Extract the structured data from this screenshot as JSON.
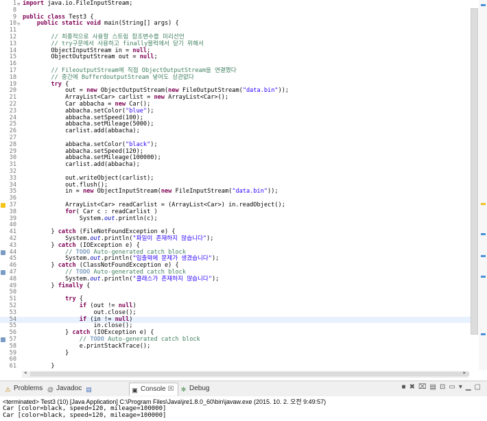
{
  "editor": {
    "lines": [
      {
        "n": "1",
        "fold": "+",
        "code": "import java.io.FileInputStream;"
      },
      {
        "n": "8",
        "code": ""
      },
      {
        "n": "9",
        "code": "public class Test3 {"
      },
      {
        "n": "10",
        "fold": "-",
        "code": "    public static void main(String[] args) {"
      },
      {
        "n": "11",
        "code": ""
      },
      {
        "n": "12",
        "code": "        // 최종적으로 사용할 스트림 참조변수를 미리선언"
      },
      {
        "n": "13",
        "code": "        // try구문에서 사용하고 finally블럭에서 닫기 위해서"
      },
      {
        "n": "14",
        "code": "        ObjectInputStream in = null;"
      },
      {
        "n": "15",
        "code": "        ObjectOutputStream out = null;"
      },
      {
        "n": "16",
        "code": ""
      },
      {
        "n": "17",
        "code": "        // FileoutputStream에 직접 ObjectOutputStream을 연결했다"
      },
      {
        "n": "18",
        "code": "        // 중간에 BufferdoutputStream 넣어도 상관없다"
      },
      {
        "n": "19",
        "code": "        try {"
      },
      {
        "n": "20",
        "code": "            out = new ObjectOutputStream(new FileOutputStream(\"data.bin\"));"
      },
      {
        "n": "21",
        "code": "            ArrayList<Car> carlist = new ArrayList<Car>();"
      },
      {
        "n": "22",
        "code": "            Car abbacha = new Car();"
      },
      {
        "n": "23",
        "code": "            abbacha.setColor(\"blue\");"
      },
      {
        "n": "24",
        "code": "            abbacha.setSpeed(100);"
      },
      {
        "n": "25",
        "code": "            abbacha.setMileage(5000);"
      },
      {
        "n": "26",
        "code": "            carlist.add(abbacha);"
      },
      {
        "n": "27",
        "code": ""
      },
      {
        "n": "28",
        "code": "            abbacha.setColor(\"black\");"
      },
      {
        "n": "29",
        "code": "            abbacha.setSpeed(120);"
      },
      {
        "n": "30",
        "code": "            abbacha.setMileage(100000);"
      },
      {
        "n": "31",
        "code": "            carlist.add(abbacha);"
      },
      {
        "n": "32",
        "code": ""
      },
      {
        "n": "33",
        "code": "            out.writeObject(carlist);"
      },
      {
        "n": "34",
        "code": "            out.flush();"
      },
      {
        "n": "35",
        "code": "            in = new ObjectInputStream(new FileInputStream(\"data.bin\"));"
      },
      {
        "n": "36",
        "code": ""
      },
      {
        "n": "37",
        "mark": "warn",
        "code": "            ArrayList<Car> readCarlist = (ArrayList<Car>) in.readObject();"
      },
      {
        "n": "38",
        "code": "            for( Car c : readCarlist )"
      },
      {
        "n": "39",
        "code": "                System.out.println(c);"
      },
      {
        "n": "40",
        "code": ""
      },
      {
        "n": "41",
        "code": "        } catch (FileNotFoundException e) {"
      },
      {
        "n": "42",
        "code": "            System.out.println(\"파일이 존재하지 않습니다\");"
      },
      {
        "n": "43",
        "code": "        } catch (IOException e) {"
      },
      {
        "n": "44",
        "mark": "task",
        "code": "            // TODO Auto-generated catch block"
      },
      {
        "n": "45",
        "code": "            System.out.println(\"입출력에 문제가 생겼습니다\");"
      },
      {
        "n": "46",
        "code": "        } catch (ClassNotFoundException e) {"
      },
      {
        "n": "47",
        "mark": "task",
        "code": "            // TODO Auto-generated catch block"
      },
      {
        "n": "48",
        "code": "            System.out.println(\"클래스가 존재하지 않습니다\");"
      },
      {
        "n": "49",
        "code": "        } finally {"
      },
      {
        "n": "50",
        "code": ""
      },
      {
        "n": "51",
        "code": "            try {"
      },
      {
        "n": "52",
        "code": "                if (out != null)"
      },
      {
        "n": "53",
        "code": "                    out.close();"
      },
      {
        "n": "54",
        "current": true,
        "code": "                if (in != null)"
      },
      {
        "n": "55",
        "code": "                    in.close();"
      },
      {
        "n": "56",
        "code": "            } catch (IOException e) {"
      },
      {
        "n": "57",
        "mark": "task",
        "code": "                // TODO Auto-generated catch block"
      },
      {
        "n": "58",
        "code": "                e.printStackTrace();"
      },
      {
        "n": "59",
        "code": "            }"
      },
      {
        "n": "60",
        "code": ""
      },
      {
        "n": "61",
        "code": "        }"
      }
    ]
  },
  "colors": {
    "keyword": "#7f0055",
    "comment": "#3f7f5f",
    "string": "#2a00ff",
    "field": "#0000c0",
    "current_line": "#e8f2fe"
  },
  "tabs": [
    {
      "label": "Problems",
      "icon": "problems-icon",
      "glyph": "⚠",
      "color": "#c08000"
    },
    {
      "label": "Javadoc",
      "icon": "javadoc-icon",
      "glyph": "@",
      "color": "#666"
    },
    {
      "label": "Declaration",
      "icon": "declaration-icon",
      "glyph": "▤",
      "color": "#3b6cb5"
    },
    {
      "label": "Console",
      "icon": "console-icon",
      "glyph": "▣",
      "color": "#333",
      "active": true,
      "close": "☒"
    },
    {
      "label": "Debug",
      "icon": "debug-icon",
      "glyph": "✲",
      "color": "#2e7d32"
    }
  ],
  "console": {
    "terminated": "<terminated> Test3 (10) [Java Application] C:\\Program Files\\Java\\jre1.8.0_60\\bin\\javaw.exe (2015. 10. 2. 오전 9:49:57)",
    "output": [
      "Car [color=black, speed=120, mileage=100000]",
      "Car [color=black, speed=120, mileage=100000]"
    ]
  }
}
